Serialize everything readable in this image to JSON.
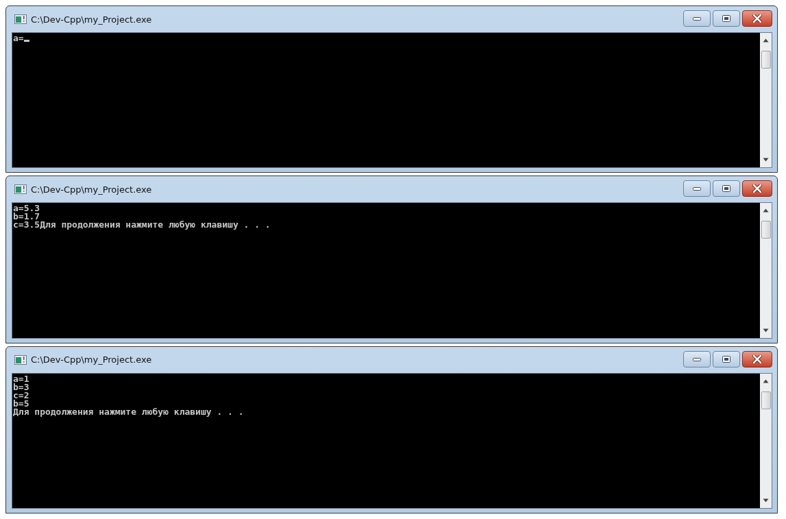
{
  "windows": [
    {
      "title": "C:\\Dev-Cpp\\my_Project.exe",
      "lines": [
        "a="
      ],
      "cursor": true
    },
    {
      "title": "C:\\Dev-Cpp\\my_Project.exe",
      "lines": [
        "a=5.3",
        "b=1.7",
        "c=3.5Для продолжения нажмите любую клавишу . . ."
      ],
      "cursor": false
    },
    {
      "title": "C:\\Dev-Cpp\\my_Project.exe",
      "lines": [
        "a=1",
        "b=3",
        "c=2",
        "b=5",
        "Для продолжения нажмите любую клавишу . . ."
      ],
      "cursor": false
    }
  ]
}
